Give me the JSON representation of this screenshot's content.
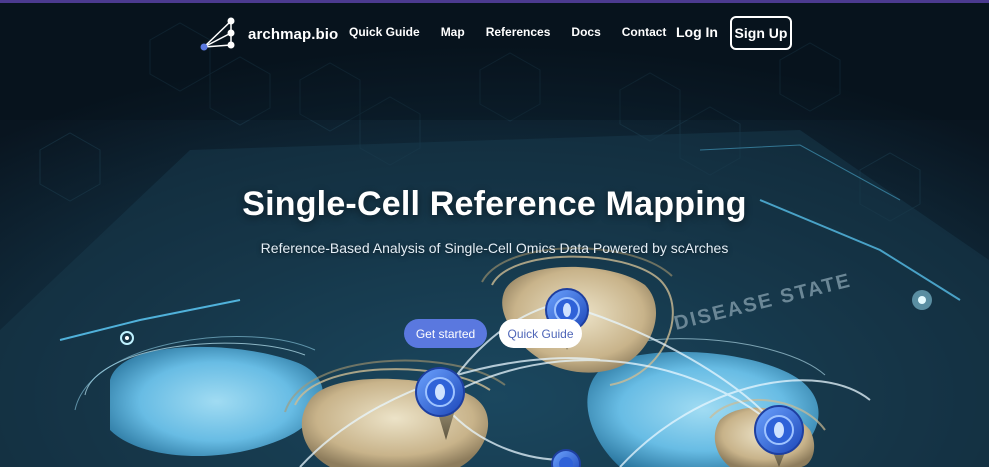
{
  "brand": {
    "name": "archmap.bio",
    "logo_icon": "network-graph-icon"
  },
  "nav": {
    "links": [
      "Quick Guide",
      "Map",
      "References",
      "Docs",
      "Contact"
    ],
    "login_label": "Log In",
    "signup_label": "Sign Up"
  },
  "hero": {
    "title": "Single-Cell Reference Mapping",
    "subtitle": "Reference-Based Analysis of Single-Cell Omics Data Powered by scArches",
    "primary_cta": "Get started",
    "secondary_cta": "Quick Guide",
    "background_label": "DISEASE STATE",
    "marker_icon": "map-pin-icon"
  },
  "colors": {
    "background": "#0b1822",
    "primary_button": "#5a78df",
    "secondary_button_text": "#4f66b8",
    "accent_cell_blue": "#6fc7ef",
    "accent_cell_tan": "#c9b58a"
  }
}
